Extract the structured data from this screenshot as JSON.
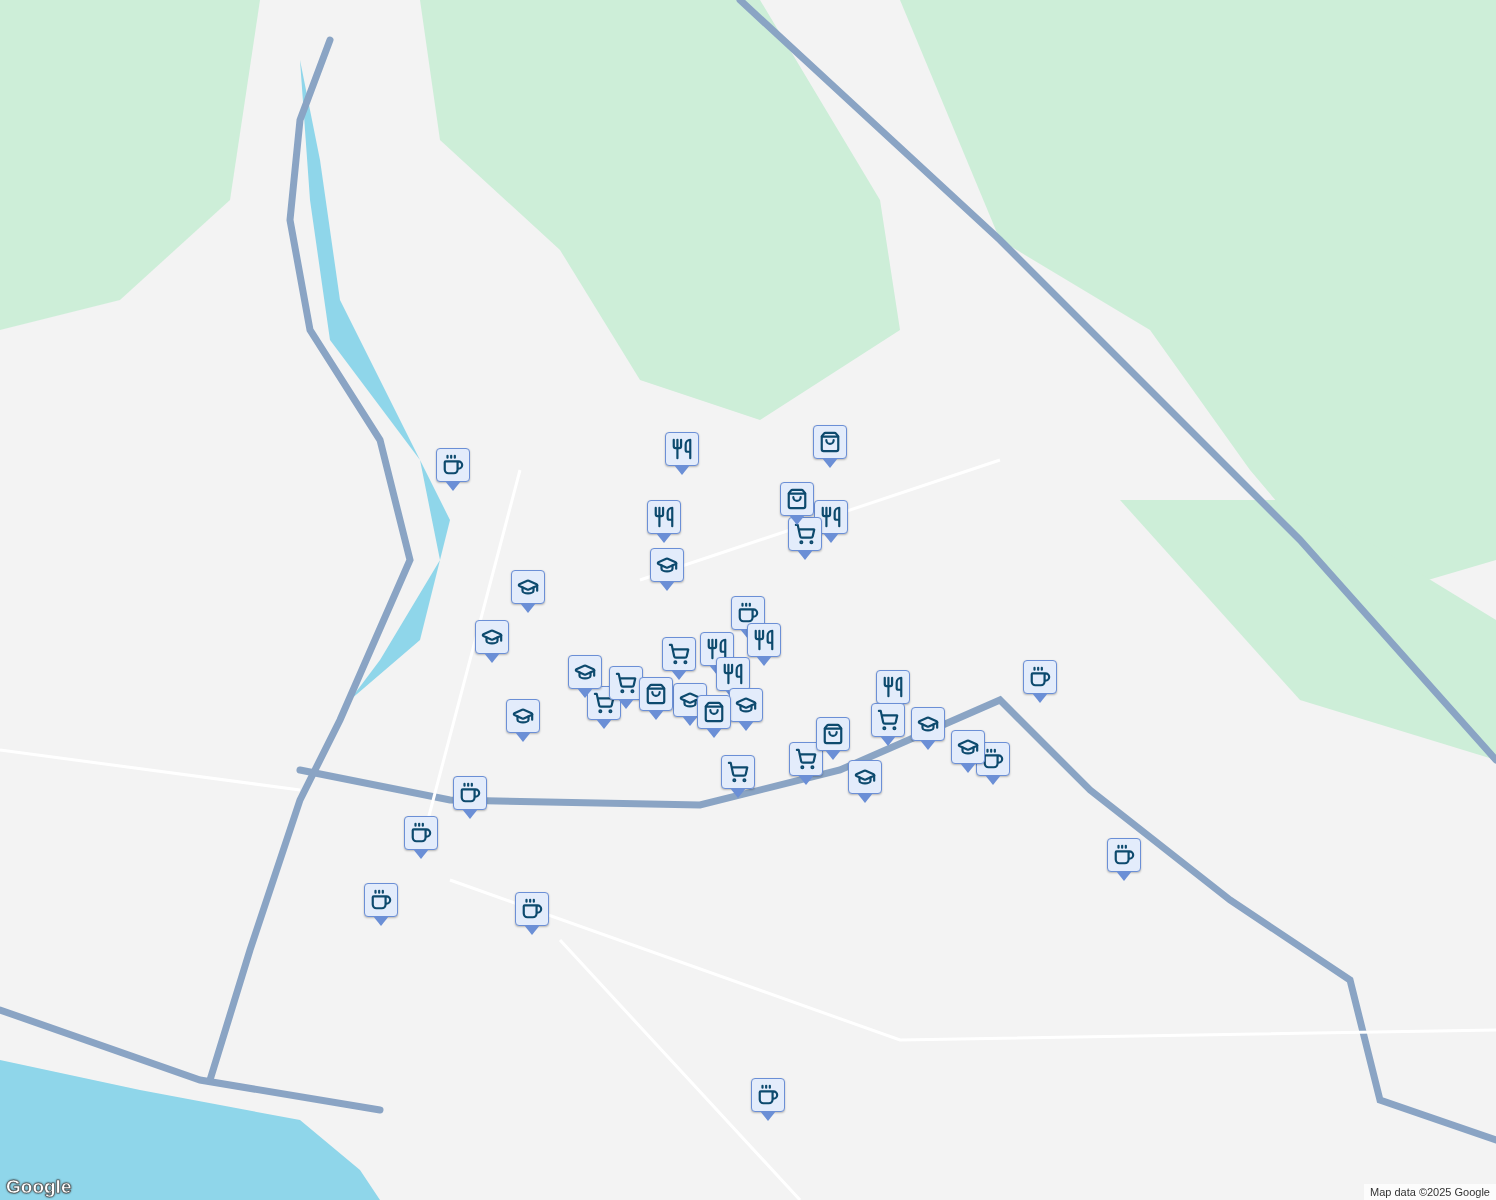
{
  "map": {
    "markers": [
      {
        "kind": "cafe"
      },
      {
        "kind": "cafe"
      },
      {
        "kind": "cafe"
      },
      {
        "kind": "cafe"
      },
      {
        "kind": "cafe"
      },
      {
        "kind": "cafe"
      },
      {
        "kind": "cafe"
      },
      {
        "kind": "cafe"
      },
      {
        "kind": "cafe"
      },
      {
        "kind": "cafe"
      },
      {
        "kind": "restaurant"
      },
      {
        "kind": "restaurant"
      },
      {
        "kind": "restaurant"
      },
      {
        "kind": "restaurant"
      },
      {
        "kind": "restaurant"
      },
      {
        "kind": "restaurant"
      },
      {
        "kind": "restaurant"
      },
      {
        "kind": "shopping"
      },
      {
        "kind": "shopping"
      },
      {
        "kind": "shopping"
      },
      {
        "kind": "shopping"
      },
      {
        "kind": "shopping"
      },
      {
        "kind": "grocery"
      },
      {
        "kind": "grocery"
      },
      {
        "kind": "grocery"
      },
      {
        "kind": "grocery"
      },
      {
        "kind": "grocery"
      },
      {
        "kind": "grocery"
      },
      {
        "kind": "grocery"
      },
      {
        "kind": "school"
      },
      {
        "kind": "school"
      },
      {
        "kind": "school"
      },
      {
        "kind": "school"
      },
      {
        "kind": "school"
      },
      {
        "kind": "school"
      },
      {
        "kind": "school"
      },
      {
        "kind": "school"
      },
      {
        "kind": "school"
      },
      {
        "kind": "school"
      }
    ],
    "logo": "Google",
    "attribution": "Map data ©2025 Google"
  }
}
